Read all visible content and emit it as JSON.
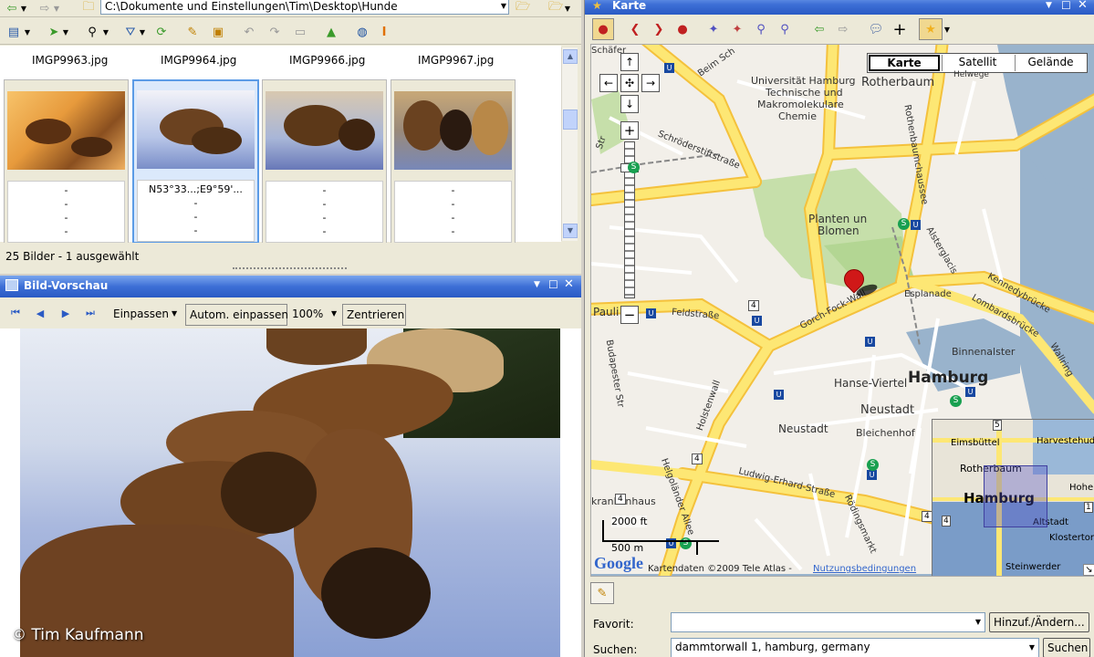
{
  "explorer": {
    "address_path": "C:\\Dokumente und Einstellungen\\Tim\\Desktop\\Hunde",
    "files": [
      {
        "name": "IMGP9963.jpg",
        "lines": [
          "-",
          "-",
          "-",
          "-"
        ]
      },
      {
        "name": "IMGP9964.jpg",
        "lines": [
          "N53°33...;E9°59'...",
          "-",
          "-",
          "-"
        ]
      },
      {
        "name": "IMGP9966.jpg",
        "lines": [
          "-",
          "-",
          "-",
          "-"
        ]
      },
      {
        "name": "IMGP9967.jpg",
        "lines": [
          "-",
          "-",
          "-",
          "-"
        ]
      }
    ],
    "status": "25 Bilder - 1 ausgewählt"
  },
  "preview": {
    "title": "Bild-Vorschau",
    "fit_label": "Einpassen",
    "auto_fit_label": "Autom. einpassen",
    "zoom": "100%",
    "center_label": "Zentrieren",
    "copyright": "© Tim Kaufmann"
  },
  "map_panel": {
    "title": "Karte",
    "view_types": [
      "Karte",
      "Satellit",
      "Gelände"
    ],
    "active_view": "Karte",
    "labels": {
      "rotherbaum": "Rotherbaum",
      "univ1": "Universität Hamburg",
      "univ2": "Technische und",
      "univ3": "Makromolekulare",
      "univ4": "Chemie",
      "planten1": "Planten un",
      "planten2": "Blomen",
      "hamburg": "Hamburg",
      "binnenalster": "Binnenalster",
      "hanse": "Hanse-Viertel",
      "neustadt1": "Neustadt",
      "neustadt2": "Neustadt",
      "bleichenhof": "Bleichenhof",
      "pauli": "Pauli",
      "krankenhaus": "krankenhaus",
      "helwege": "Helwege"
    },
    "streets": {
      "beim_sch": "Beim Sch",
      "schroeder": "Schröderstiftstraße",
      "rothenbaum": "Rothenbaumchaussee",
      "feldstr": "Feldstraße",
      "gorch": "Gorch-Fock-Wall",
      "esplanade": "Esplanade",
      "lombards": "Lombardsbrücke",
      "kennedy": "Kennedybrücke",
      "alsterglacis": "Alsterglacis",
      "holstenwall": "Holstenwall",
      "ludwig": "Ludwig-Erhard-Straße",
      "budapester": "Budapester Str",
      "helgolaender": "Helgoländer Allee",
      "roedingsmarkt": "Rödingsmarkt",
      "wallring": "Wallring",
      "schaefer": "Schäfer",
      "str": "Str"
    },
    "road_numbers": [
      "4",
      "4",
      "4",
      "4"
    ],
    "scale_ft": "2000 ft",
    "scale_m": "500 m",
    "google": "Google",
    "copyright": "Kartendaten ©2009 Tele Atlas -",
    "terms_link": "Nutzungsbedingungen",
    "overview": {
      "eimsbuettel": "Eimsbüttel",
      "harvestehude": "Harvestehude",
      "rotherbaum": "Rotherbaum",
      "hamburg": "Hamburg",
      "altstadt": "Altstadt",
      "hohenf": "Hohenf",
      "klostertor": "Klostertor",
      "steinwerder": "Steinwerder",
      "num5": "5",
      "num4": "4",
      "num1": "1"
    },
    "favorit_label": "Favorit:",
    "favorit_value": "",
    "add_change_btn": "Hinzuf./Ändern...",
    "search_label": "Suchen:",
    "search_value": "dammtorwall 1, hamburg, germany",
    "search_btn": "Suchen"
  },
  "colors": {
    "titlebar": "#3d6fd6",
    "road": "#fde774",
    "map_bg": "#f2efe9",
    "park": "#c6dfaa",
    "water": "#99b3cc"
  }
}
